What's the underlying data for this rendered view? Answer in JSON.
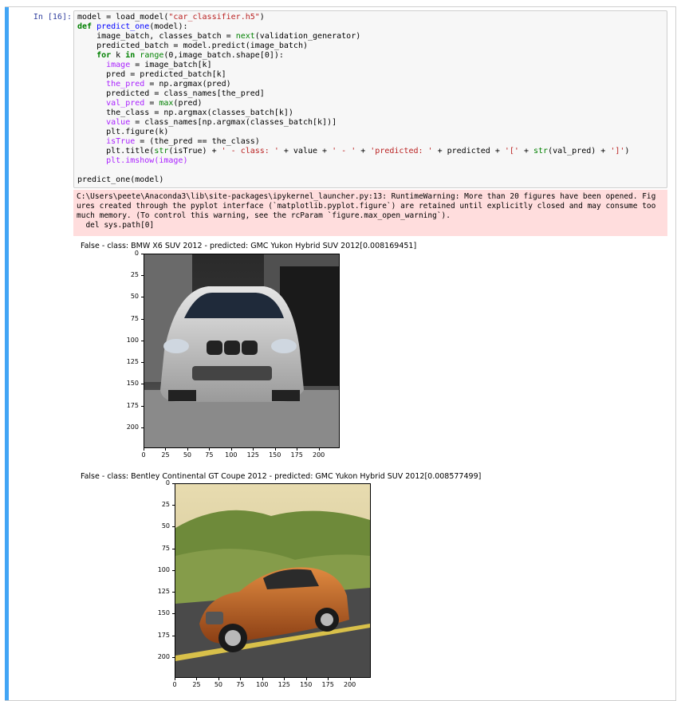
{
  "prompt_label": "In [16]:",
  "code_lines": [
    [
      {
        "t": "model = load_model(",
        "c": ""
      },
      {
        "t": "\"car_classifier.h5\"",
        "c": "s"
      },
      {
        "t": ")",
        "c": ""
      }
    ],
    [
      {
        "t": "def ",
        "c": "k"
      },
      {
        "t": "predict_one",
        "c": "f"
      },
      {
        "t": "(model):",
        "c": ""
      }
    ],
    [
      {
        "t": "    image_batch, classes_batch = ",
        "c": ""
      },
      {
        "t": "next",
        "c": "nb"
      },
      {
        "t": "(validation_generator)",
        "c": ""
      }
    ],
    [
      {
        "t": "    predicted_batch = model.predict(image_batch)",
        "c": ""
      }
    ],
    [
      {
        "t": "    ",
        "c": ""
      },
      {
        "t": "for",
        "c": "k"
      },
      {
        "t": " k ",
        "c": ""
      },
      {
        "t": "in",
        "c": "k"
      },
      {
        "t": " ",
        "c": ""
      },
      {
        "t": "range",
        "c": "nb"
      },
      {
        "t": "(0,image_batch.shape[0]):",
        "c": ""
      }
    ],
    [
      {
        "t": "      ",
        "c": ""
      },
      {
        "t": "image",
        "c": "v"
      },
      {
        "t": " = image_batch[k]",
        "c": ""
      }
    ],
    [
      {
        "t": "      pred = predicted_batch[k]",
        "c": ""
      }
    ],
    [
      {
        "t": "      ",
        "c": ""
      },
      {
        "t": "the_pred",
        "c": "v"
      },
      {
        "t": " = np.argmax(pred)",
        "c": ""
      }
    ],
    [
      {
        "t": "      predicted = class_names[the_pred]",
        "c": ""
      }
    ],
    [
      {
        "t": "      ",
        "c": ""
      },
      {
        "t": "val_pred",
        "c": "v"
      },
      {
        "t": " = ",
        "c": ""
      },
      {
        "t": "max",
        "c": "nb"
      },
      {
        "t": "(pred)",
        "c": ""
      }
    ],
    [
      {
        "t": "      the_class = np.argmax(classes_batch[k])",
        "c": ""
      }
    ],
    [
      {
        "t": "      ",
        "c": ""
      },
      {
        "t": "value",
        "c": "v"
      },
      {
        "t": " = class_names[np.argmax(classes_batch[k])]",
        "c": ""
      }
    ],
    [
      {
        "t": "      plt.figure(k)",
        "c": ""
      }
    ],
    [
      {
        "t": "      ",
        "c": ""
      },
      {
        "t": "isTrue",
        "c": "v"
      },
      {
        "t": " = (the_pred == the_class)",
        "c": ""
      }
    ],
    [
      {
        "t": "      plt.title(",
        "c": ""
      },
      {
        "t": "str",
        "c": "nb"
      },
      {
        "t": "(isTrue) + ",
        "c": ""
      },
      {
        "t": "' - class: '",
        "c": "s"
      },
      {
        "t": " + value + ",
        "c": ""
      },
      {
        "t": "' - '",
        "c": "s"
      },
      {
        "t": " + ",
        "c": ""
      },
      {
        "t": "'predicted: '",
        "c": "s"
      },
      {
        "t": " + predicted + ",
        "c": ""
      },
      {
        "t": "'['",
        "c": "s"
      },
      {
        "t": " + ",
        "c": ""
      },
      {
        "t": "str",
        "c": "nb"
      },
      {
        "t": "(val_pred) + ",
        "c": ""
      },
      {
        "t": "']'",
        "c": "s"
      },
      {
        "t": ")",
        "c": ""
      }
    ],
    [
      {
        "t": "      ",
        "c": ""
      },
      {
        "t": "plt.imshow(image)",
        "c": "v"
      }
    ],
    [
      {
        "t": "",
        "c": ""
      }
    ],
    [
      {
        "t": "predict_one(model)",
        "c": ""
      }
    ]
  ],
  "stderr_lines": [
    "C:\\Users\\peete\\Anaconda3\\lib\\site-packages\\ipykernel_launcher.py:13: RuntimeWarning: More than 20 figures have been opened. Fig",
    "ures created through the pyplot interface (`matplotlib.pyplot.figure`) are retained until explicitly closed and may consume too",
    "much memory. (To control this warning, see the rcParam `figure.max_open_warning`).",
    "  del sys.path[0]"
  ],
  "figures": [
    {
      "title": "False - class: BMW X6 SUV 2012 - predicted: GMC Yukon Hybrid SUV 2012[0.008169451]",
      "image_desc": "silver-car-icon",
      "y_ticks": [
        "0",
        "25",
        "50",
        "75",
        "100",
        "125",
        "150",
        "175",
        "200"
      ],
      "x_ticks": [
        "0",
        "25",
        "50",
        "75",
        "100",
        "125",
        "150",
        "175",
        "200"
      ]
    },
    {
      "title": "False - class: Bentley Continental GT Coupe 2012 - predicted: GMC Yukon Hybrid SUV 2012[0.008577499]",
      "image_desc": "orange-car-icon",
      "y_ticks": [
        "0",
        "25",
        "50",
        "75",
        "100",
        "125",
        "150",
        "175",
        "200"
      ],
      "x_ticks": [
        "0",
        "25",
        "50",
        "75",
        "100",
        "125",
        "150",
        "175",
        "200"
      ]
    }
  ],
  "colors": {
    "cell_bar": "#42a5f5",
    "prompt": "#303f9f",
    "input_bg": "#f7f7f7",
    "stderr_bg": "#ffdddd"
  }
}
